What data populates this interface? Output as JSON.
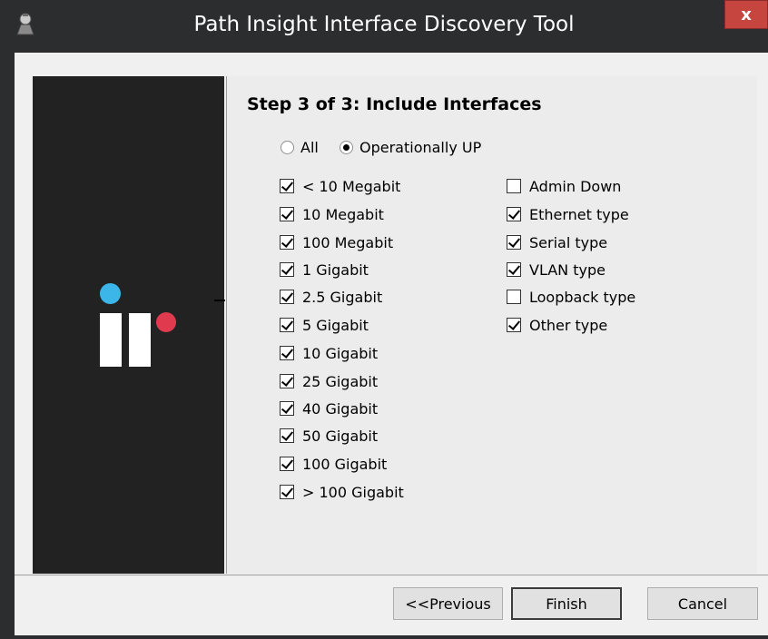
{
  "window": {
    "title": "Path Insight Interface Discovery Tool",
    "close_label": "x",
    "icon": "wizard-app-icon"
  },
  "colors": {
    "titlebar": "#2b2d2f",
    "close": "#c7453f",
    "side_panel": "#222222",
    "logo_blue": "#3cb5e8",
    "logo_red": "#e03a4e"
  },
  "step": {
    "title": "Step 3 of 3: Include Interfaces"
  },
  "scope": {
    "options": [
      {
        "label": "All",
        "selected": false
      },
      {
        "label": "Operationally UP",
        "selected": true
      }
    ]
  },
  "speeds": [
    {
      "label": "< 10 Megabit",
      "checked": true
    },
    {
      "label": "10 Megabit",
      "checked": true
    },
    {
      "label": "100 Megabit",
      "checked": true
    },
    {
      "label": "1 Gigabit",
      "checked": true
    },
    {
      "label": "2.5 Gigabit",
      "checked": true
    },
    {
      "label": "5 Gigabit",
      "checked": true
    },
    {
      "label": "10 Gigabit",
      "checked": true
    },
    {
      "label": "25 Gigabit",
      "checked": true
    },
    {
      "label": "40 Gigabit",
      "checked": true
    },
    {
      "label": "50 Gigabit",
      "checked": true
    },
    {
      "label": "100 Gigabit",
      "checked": true
    },
    {
      "label": "> 100 Gigabit",
      "checked": true
    }
  ],
  "types": [
    {
      "label": "Admin Down",
      "checked": false
    },
    {
      "label": "Ethernet type",
      "checked": true
    },
    {
      "label": "Serial type",
      "checked": true
    },
    {
      "label": "VLAN type",
      "checked": true
    },
    {
      "label": "Loopback type",
      "checked": false
    },
    {
      "label": "Other type",
      "checked": true
    }
  ],
  "buttons": {
    "previous": "<<Previous",
    "finish": "Finish",
    "cancel": "Cancel"
  }
}
